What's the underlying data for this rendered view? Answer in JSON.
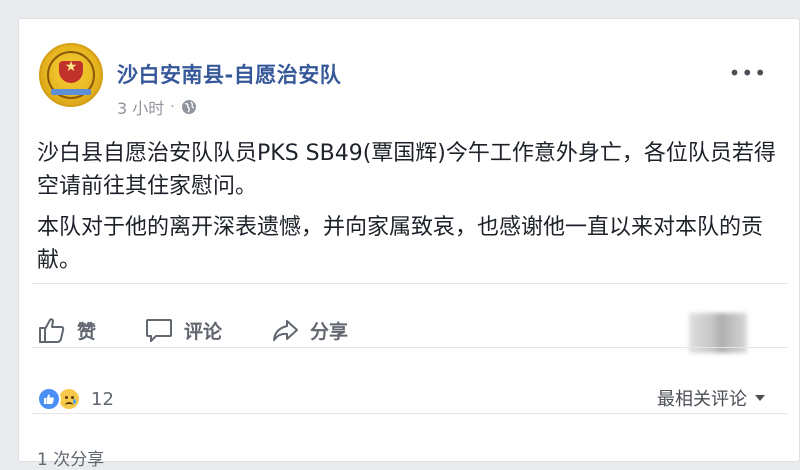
{
  "post": {
    "page_name": "沙白安南县-自愿治安队",
    "time": "3 小时",
    "separator": "·",
    "more_label": "•••",
    "paragraphs": [
      "沙白县自愿治安队队员PKS SB49(覃国辉)今午工作意外身亡，各位队员若得空请前往其住家慰问。",
      "本队对于他的离开深表遗憾，并向家属致哀，也感谢他一直以来对本队的贡献。"
    ]
  },
  "actions": {
    "like": "赞",
    "comment": "评论",
    "share": "分享"
  },
  "reactions": {
    "count": "12"
  },
  "comments": {
    "sort_label": "最相关评论"
  },
  "footer": {
    "shares": "1 次分享"
  },
  "colors": {
    "link": "#365899",
    "muted": "#90949c",
    "action_text": "#616770",
    "like_blue": "#4b8ff5",
    "sad_yellow": "#f7c94b"
  },
  "icons": [
    "globe-icon",
    "thumbs-up-icon",
    "comment-icon",
    "share-icon",
    "like-reaction-icon",
    "sad-reaction-icon",
    "caret-down-icon"
  ]
}
